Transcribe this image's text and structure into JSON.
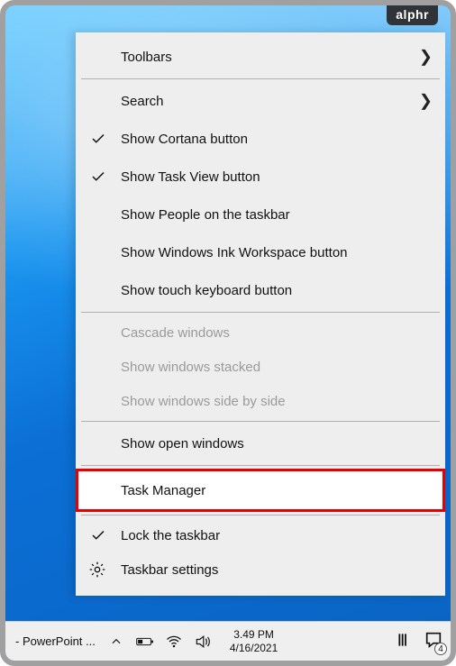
{
  "watermark": "alphr",
  "menu": {
    "toolbars": "Toolbars",
    "search": "Search",
    "show_cortana": "Show Cortana button",
    "show_task_view": "Show Task View button",
    "show_people": "Show People on the taskbar",
    "show_ink": "Show Windows Ink Workspace button",
    "show_touch_kb": "Show touch keyboard button",
    "cascade": "Cascade windows",
    "stacked": "Show windows stacked",
    "side_by_side": "Show windows side by side",
    "show_open": "Show open windows",
    "task_manager": "Task Manager",
    "lock_taskbar": "Lock the taskbar",
    "taskbar_settings": "Taskbar settings"
  },
  "taskbar": {
    "app": "- PowerPoint ...",
    "time": "3.49 PM",
    "date": "4/16/2021",
    "notif_count": "4"
  },
  "icons": {
    "chevron_right": "❯",
    "chevron_up": "︿"
  }
}
